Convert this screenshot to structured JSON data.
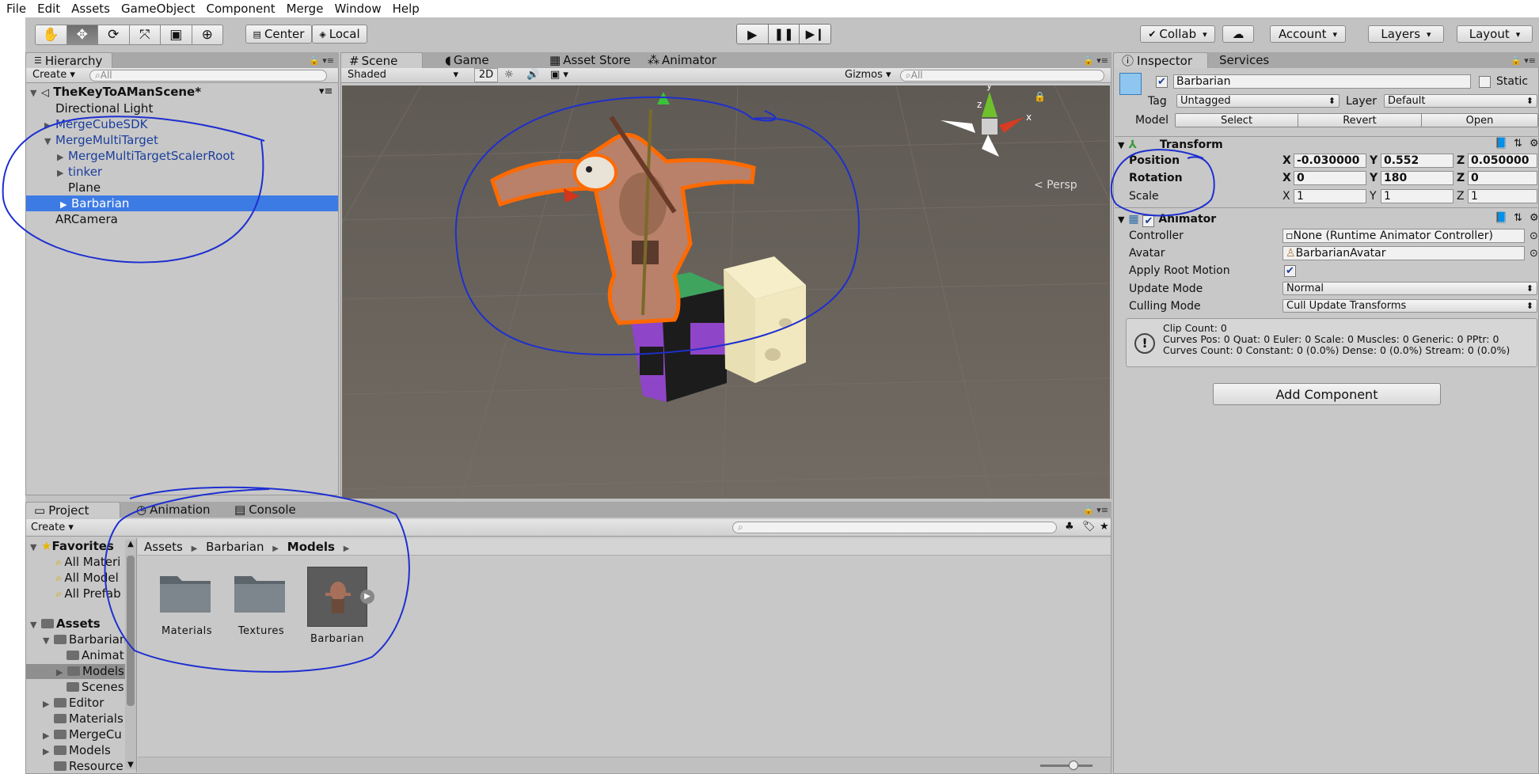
{
  "menu": [
    "File",
    "Edit",
    "Assets",
    "GameObject",
    "Component",
    "Merge",
    "Window",
    "Help"
  ],
  "toolbar": {
    "tools": [
      "hand-tool-icon",
      "move-tool-icon",
      "rotate-tool-icon",
      "scale-tool-icon",
      "rect-tool-icon",
      "transform-tool-icon"
    ],
    "pivot": "Center",
    "space": "Local",
    "collab": "Collab",
    "account": "Account",
    "layers": "Layers",
    "layout": "Layout"
  },
  "hierarchy": {
    "tab": "Hierarchy",
    "create": "Create",
    "search_placeholder": "All",
    "scene_name": "TheKeyToAManScene*",
    "items": [
      {
        "label": "Directional Light",
        "prefab": false,
        "expander": ""
      },
      {
        "label": "MergeCubeSDK",
        "prefab": true,
        "expander": "▶"
      },
      {
        "label": "MergeMultiTarget",
        "prefab": true,
        "expander": "▼"
      },
      {
        "label": "MergeMultiTargetScalerRoot",
        "prefab": true,
        "expander": "▶"
      },
      {
        "label": "tinker",
        "prefab": true,
        "expander": "▶"
      },
      {
        "label": "Plane",
        "prefab": false,
        "expander": ""
      },
      {
        "label": "Barbarian",
        "prefab": true,
        "expander": "▶",
        "selected": true
      },
      {
        "label": "ARCamera",
        "prefab": false,
        "expander": ""
      }
    ]
  },
  "scene": {
    "tabs": [
      "Scene",
      "Game",
      "Asset Store",
      "Animator"
    ],
    "shading": "Shaded",
    "mode_2d": "2D",
    "gizmos": "Gizmos",
    "search_placeholder": "All",
    "persp_label": "< Persp",
    "axes": {
      "x": "x",
      "y": "y",
      "z": "z"
    }
  },
  "inspector": {
    "tabs": [
      "Inspector",
      "Services"
    ],
    "object_name": "Barbarian",
    "static_label": "Static",
    "tag_label": "Tag",
    "tag_value": "Untagged",
    "layer_label": "Layer",
    "layer_value": "Default",
    "model_label": "Model",
    "model_buttons": [
      "Select",
      "Revert",
      "Open"
    ],
    "transform": {
      "title": "Transform",
      "position_label": "Position",
      "rotation_label": "Rotation",
      "scale_label": "Scale",
      "position": {
        "x": "-0.030000",
        "y": "0.552",
        "z": "0.050000"
      },
      "rotation": {
        "x": "0",
        "y": "180",
        "z": "0"
      },
      "scale": {
        "x": "1",
        "y": "1",
        "z": "1"
      }
    },
    "animator": {
      "title": "Animator",
      "controller_label": "Controller",
      "controller_value": "None (Runtime Animator Controller)",
      "avatar_label": "Avatar",
      "avatar_value": "BarbarianAvatar",
      "root_motion_label": "Apply Root Motion",
      "update_mode_label": "Update Mode",
      "update_mode_value": "Normal",
      "culling_mode_label": "Culling Mode",
      "culling_mode_value": "Cull Update Transforms",
      "info_line1": "Clip Count: 0",
      "info_line2": "Curves Pos: 0 Quat: 0 Euler: 0 Scale: 0 Muscles: 0 Generic: 0 PPtr: 0",
      "info_line3": "Curves Count: 0 Constant: 0 (0.0%) Dense: 0 (0.0%) Stream: 0 (0.0%)"
    },
    "add_component": "Add Component"
  },
  "project": {
    "tabs": [
      "Project",
      "Animation",
      "Console"
    ],
    "create": "Create",
    "breadcrumb": [
      "Assets",
      "Barbarian",
      "Models"
    ],
    "favorites_label": "Favorites",
    "favorites": [
      "All Materi",
      "All Model",
      "All Prefab"
    ],
    "assets_label": "Assets",
    "tree": [
      {
        "label": "Barbarian",
        "indent": 1,
        "expander": "▼"
      },
      {
        "label": "Animat",
        "indent": 2,
        "expander": ""
      },
      {
        "label": "Models",
        "indent": 2,
        "expander": "▶",
        "selected": true
      },
      {
        "label": "Scenes",
        "indent": 2,
        "expander": ""
      },
      {
        "label": "Editor",
        "indent": 1,
        "expander": "▶"
      },
      {
        "label": "Materials",
        "indent": 1,
        "expander": ""
      },
      {
        "label": "MergeCu",
        "indent": 1,
        "expander": "▶"
      },
      {
        "label": "Models",
        "indent": 1,
        "expander": "▶"
      },
      {
        "label": "Resource",
        "indent": 1,
        "expander": ""
      }
    ],
    "grid": [
      "Materials",
      "Textures",
      "Barbarian"
    ]
  },
  "colors": {
    "selection": "#3d7be4",
    "prefab_text": "#1c3e9c",
    "annotation_ink": "#1e2fd0",
    "outline": "#ff6a00"
  }
}
